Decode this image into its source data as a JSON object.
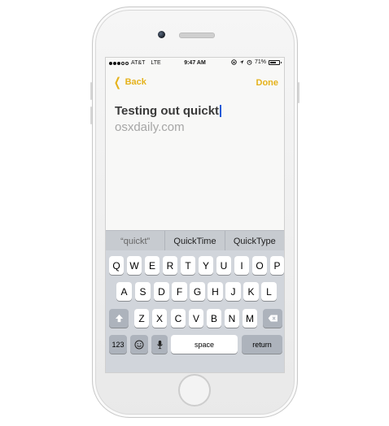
{
  "status_bar": {
    "carrier": "AT&T",
    "network": "LTE",
    "time": "9:47 AM",
    "battery_percent": "71%",
    "battery_level": 0.71,
    "icons": [
      "lock-rotation-icon",
      "location-icon",
      "alarm-icon"
    ]
  },
  "navbar": {
    "back_label": "Back",
    "done_label": "Done",
    "accent_color": "#e5b21b"
  },
  "note": {
    "typed_text": "Testing out quickt",
    "suggestion_text": "osxdaily.com"
  },
  "quicktype": {
    "suggestions": [
      "“quickt”",
      "QuickTime",
      "QuickType"
    ]
  },
  "keyboard": {
    "row1": [
      "Q",
      "W",
      "E",
      "R",
      "T",
      "Y",
      "U",
      "I",
      "O",
      "P"
    ],
    "row2": [
      "A",
      "S",
      "D",
      "F",
      "G",
      "H",
      "J",
      "K",
      "L"
    ],
    "row3": [
      "Z",
      "X",
      "C",
      "V",
      "B",
      "N",
      "M"
    ],
    "numbers_label": "123",
    "space_label": "space",
    "return_label": "return"
  }
}
